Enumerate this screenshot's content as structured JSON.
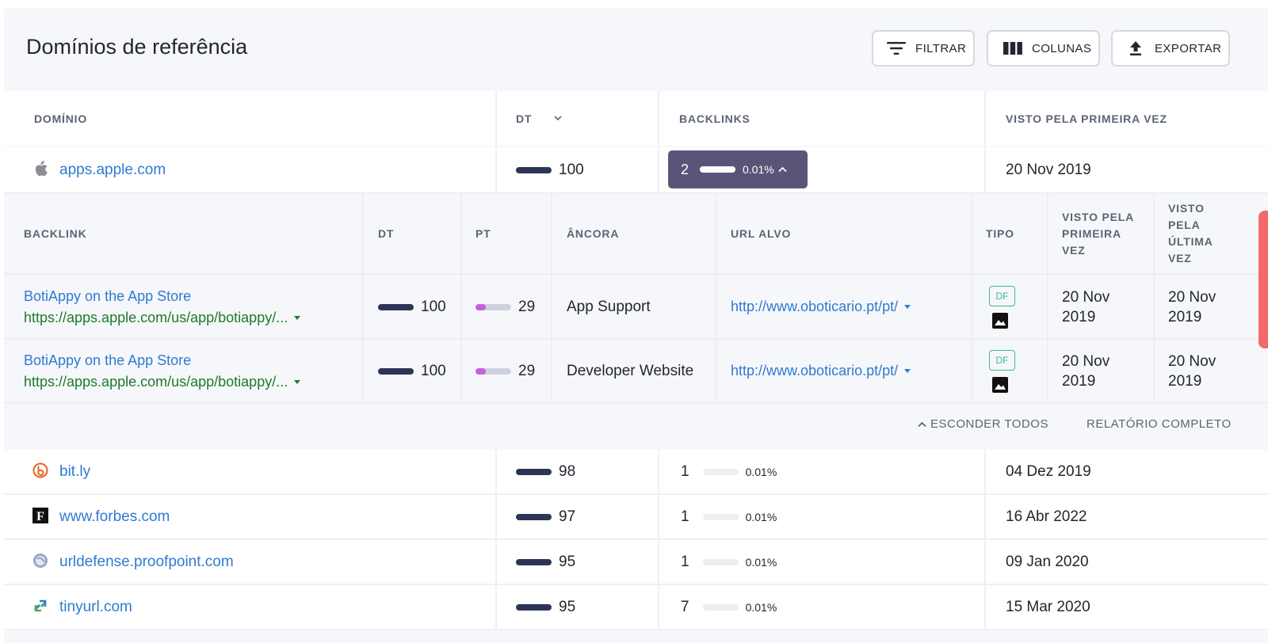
{
  "header": {
    "title": "Domínios de referência",
    "buttons": {
      "filter": "FILTRAR",
      "columns": "COLUNAS",
      "export": "EXPORTAR"
    }
  },
  "table": {
    "columns": {
      "domain": "DOMÍNIO",
      "dt": "DT",
      "backlinks": "BACKLINKS",
      "first_seen": "VISTO PELA PRIMEIRA VEZ"
    },
    "expanded_row": {
      "domain": "apps.apple.com",
      "favicon": "apple-icon",
      "dt": "100",
      "dt_fill": 1.0,
      "backlinks": "2",
      "backlinks_pct": "0.01%",
      "first_seen": "20 Nov 2019"
    },
    "rows": [
      {
        "domain": "bit.ly",
        "favicon": "bitly-icon",
        "dt": "98",
        "dt_fill": 0.98,
        "backlinks": "1",
        "backlinks_pct": "0.01%",
        "first_seen": "04 Dez 2019"
      },
      {
        "domain": "www.forbes.com",
        "favicon": "forbes-icon",
        "dt": "97",
        "dt_fill": 0.97,
        "backlinks": "1",
        "backlinks_pct": "0.01%",
        "first_seen": "16 Abr 2022"
      },
      {
        "domain": "urldefense.proofpoint.com",
        "favicon": "globe-icon",
        "dt": "95",
        "dt_fill": 0.95,
        "backlinks": "1",
        "backlinks_pct": "0.01%",
        "first_seen": "09 Jan 2020"
      },
      {
        "domain": "tinyurl.com",
        "favicon": "tinyurl-icon",
        "dt": "95",
        "dt_fill": 0.95,
        "backlinks": "7",
        "backlinks_pct": "0.01%",
        "first_seen": "15 Mar 2020"
      }
    ]
  },
  "backlinks_panel": {
    "columns": {
      "backlink": "BACKLINK",
      "dt": "DT",
      "pt": "PT",
      "anchor": "ÂNCORA",
      "target": "URL ALVO",
      "type": "TIPO",
      "first_seen": [
        "VISTO PELA",
        "PRIMEIRA",
        "VEZ"
      ],
      "last_seen": [
        "VISTO",
        "PELA",
        "ÚLTIMA",
        "VEZ"
      ]
    },
    "rows": [
      {
        "title": "BotiAppy on the App Store",
        "url": "https://apps.apple.com/us/app/botiappy/...",
        "dt": "100",
        "pt": "29",
        "pt_fill": 0.29,
        "anchor": "App Support",
        "target": "http://www.oboticario.pt/pt/",
        "type": "DF",
        "first_seen": [
          "20 Nov",
          "2019"
        ],
        "last_seen": [
          "20 Nov",
          "2019"
        ]
      },
      {
        "title": "BotiAppy on the App Store",
        "url": "https://apps.apple.com/us/app/botiappy/...",
        "dt": "100",
        "pt": "29",
        "pt_fill": 0.29,
        "anchor": "Developer Website",
        "target": "http://www.oboticario.pt/pt/",
        "type": "DF",
        "first_seen": [
          "20 Nov",
          "2019"
        ],
        "last_seen": [
          "20 Nov",
          "2019"
        ]
      }
    ],
    "actions": {
      "hide_all": "ESCONDER TODOS",
      "full_report": "RELATÓRIO COMPLETO"
    }
  },
  "colors": {
    "link": "#2f7ad3",
    "backlink_url": "#1e7a2c",
    "dt_bar": "#2c3458",
    "pt_bar": "#c95fd8",
    "chip": "#5a5578",
    "dofollow": "#3fb98a",
    "side_tab": "#f46a6a"
  }
}
